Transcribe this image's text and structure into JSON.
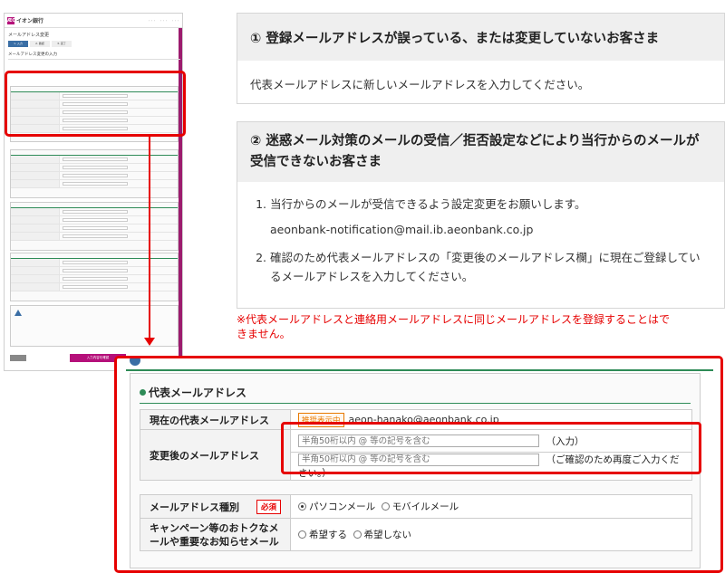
{
  "thumbnail": {
    "bank_name": "イオン銀行",
    "logo_mark": "ÆON",
    "page_title": "メールアドレス変更",
    "steps": [
      "1. 入力",
      "2. 確認",
      "3. 完了"
    ],
    "section_title": "メールアドレス変更の入力",
    "confirm_button": "入力内容を確認"
  },
  "panel1": {
    "title": "① 登録メールアドレスが誤っている、または変更していないお客さま",
    "body": "代表メールアドレスに新しいメールアドレスを入力してください。"
  },
  "panel2": {
    "title": "② 迷惑メール対策のメールの受信／拒否設定などにより当行からのメールが受信できないお客さま",
    "item1": "当行からのメールが受信できるよう設定変更をお願いします。",
    "email": "aeonbank-notification@mail.ib.aeonbank.co.jp",
    "item2": "確認のため代表メールアドレスの「変更後のメールアドレス欄」に現在ご登録しているメールアドレスを入力してください。"
  },
  "warning_note": "※代表メールアドレスと連絡用メールアドレスに同じメールアドレスを登録することはできません。",
  "form": {
    "section_title": "代表メールアドレス",
    "current_label": "現在の代表メールアドレス",
    "current_badge": "推奨表示中",
    "current_value": "aeon-hanako@aeonbank.co.jp",
    "new_label": "変更後のメールアドレス",
    "input_placeholder": "半角50桁以内 @ 等の記号を含む",
    "input_suffix": "（入力）",
    "confirm_placeholder": "半角50桁以内 @ 等の記号を含む",
    "confirm_suffix": "（ご確認のため再度ご入力ください。）",
    "type_label": "メールアドレス種別",
    "required_badge": "必須",
    "type_options": [
      "パソコンメール",
      "モバイルメール"
    ],
    "type_selected": "パソコンメール",
    "promo_label": "キャンペーン等のおトクなメールや重要なお知らせメール",
    "promo_options": [
      "希望する",
      "希望しない"
    ]
  },
  "colors": {
    "highlight_red": "#e60000",
    "brand_magenta": "#b5107a",
    "section_green": "#2e8b57",
    "badge_orange": "#e87a00"
  }
}
